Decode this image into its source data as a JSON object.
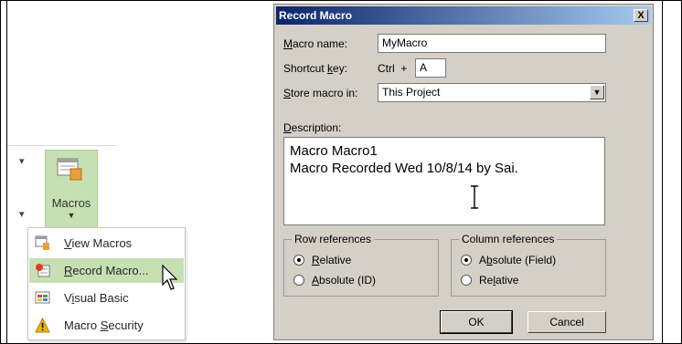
{
  "ribbon": {
    "macros_label": "Macros",
    "menu_items": [
      {
        "pre": "",
        "key": "V",
        "post": "iew Macros",
        "icon": "view-macros-icon"
      },
      {
        "pre": "",
        "key": "R",
        "post": "ecord Macro...",
        "icon": "record-macro-icon"
      },
      {
        "pre": "V",
        "key": "i",
        "post": "sual Basic",
        "icon": "visual-basic-icon"
      },
      {
        "pre": "Macro ",
        "key": "S",
        "post": "ecurity",
        "icon": "warning-icon"
      }
    ]
  },
  "dialog": {
    "title": "Record Macro",
    "close_label": "X",
    "macro_name": {
      "pre": "",
      "key": "M",
      "post": "acro name:",
      "value": "MyMacro"
    },
    "shortcut": {
      "pre": "Shortcut ",
      "key": "k",
      "post": "ey:",
      "ctrl_text": "Ctrl  +",
      "value": "A"
    },
    "store": {
      "pre": "",
      "key": "S",
      "post": "tore macro in:",
      "value": "This Project"
    },
    "description": {
      "pre": "",
      "key": "D",
      "post": "escription:",
      "line1": "Macro Macro1",
      "line2": "Macro Recorded Wed 10/8/14 by Sai."
    },
    "row_refs": {
      "title": "Row references",
      "options": [
        {
          "pre": "",
          "key": "R",
          "post": "elative",
          "selected": true
        },
        {
          "pre": "",
          "key": "A",
          "post": "bsolute (ID)",
          "selected": false
        }
      ]
    },
    "col_refs": {
      "title": "Column references",
      "options": [
        {
          "pre": "A",
          "key": "b",
          "post": "solute (Field)",
          "selected": true
        },
        {
          "pre": "Re",
          "key": "l",
          "post": "ative",
          "selected": false
        }
      ]
    },
    "ok_label": "OK",
    "cancel_label": "Cancel"
  },
  "colors": {
    "highlight": "#c6e0b4",
    "titlebar": "#0a246a",
    "dialog_bg": "#d4d0c8"
  }
}
